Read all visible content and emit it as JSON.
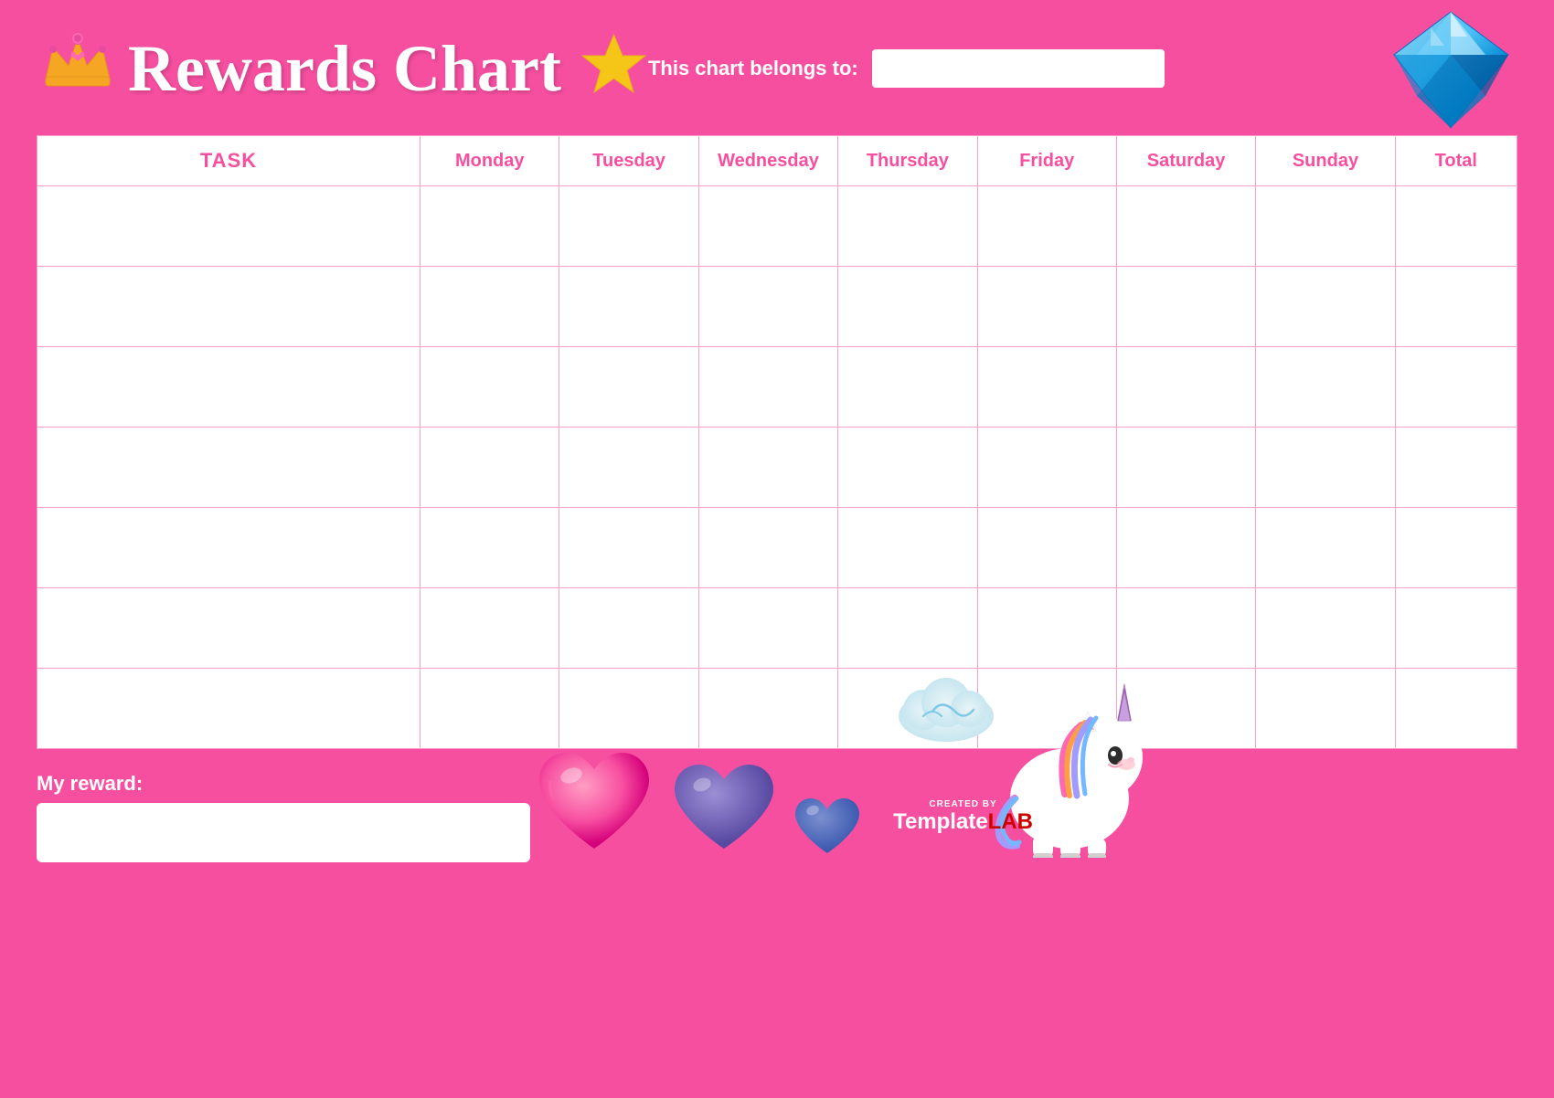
{
  "header": {
    "title": "Rewards Chart",
    "belongs_to_label": "This chart belongs to:",
    "belongs_to_placeholder": ""
  },
  "table": {
    "columns": [
      {
        "key": "task",
        "label": "TASK"
      },
      {
        "key": "monday",
        "label": "Monday"
      },
      {
        "key": "tuesday",
        "label": "Tuesday"
      },
      {
        "key": "wednesday",
        "label": "Wednesday"
      },
      {
        "key": "thursday",
        "label": "Thursday"
      },
      {
        "key": "friday",
        "label": "Friday"
      },
      {
        "key": "saturday",
        "label": "Saturday"
      },
      {
        "key": "sunday",
        "label": "Sunday"
      },
      {
        "key": "total",
        "label": "Total"
      }
    ],
    "row_count": 7
  },
  "footer": {
    "reward_label": "My reward:",
    "reward_placeholder": ""
  },
  "branding": {
    "created_by": "CREATED BY",
    "template_part": "Template",
    "lab_part": "LAB"
  },
  "colors": {
    "background": "#f74fa0",
    "table_border": "#f9a0c8",
    "header_text": "#f74fa0",
    "white": "#ffffff",
    "star_gold": "#f5c518"
  },
  "icons": {
    "crown": "👑",
    "star": "⭐"
  }
}
